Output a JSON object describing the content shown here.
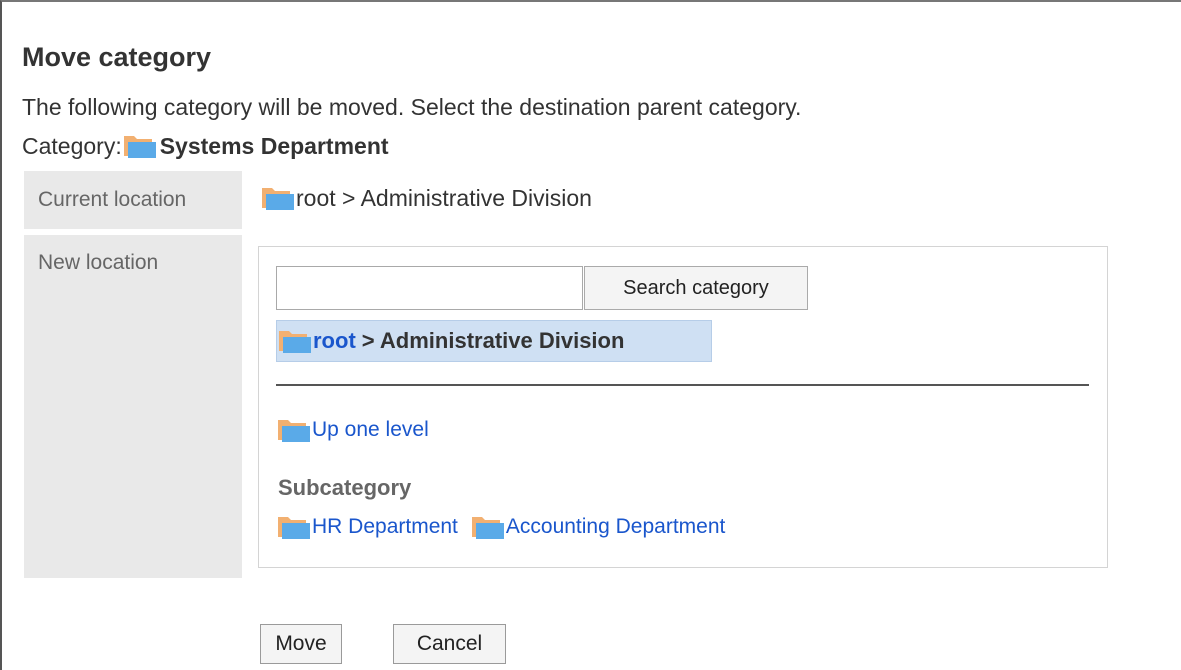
{
  "page": {
    "title": "Move category",
    "instruction": "The following category will be moved. Select the destination parent category.",
    "category_label": "Category:",
    "category_name": "Systems Department"
  },
  "current_location": {
    "label": "Current location",
    "value": "root > Administrative Division"
  },
  "new_location": {
    "label": "New location",
    "search": {
      "value": "",
      "placeholder": "",
      "button_label": "Search category"
    },
    "selected_path": {
      "root_link": "root",
      "rest": "> Administrative Division"
    },
    "up_one_level": "Up one level",
    "subcategory_heading": "Subcategory",
    "subcategories": [
      "HR Department",
      "Accounting Department"
    ]
  },
  "actions": {
    "move_label": "Move",
    "cancel_label": "Cancel"
  },
  "icons": {
    "folder": "folder-icon"
  },
  "colors": {
    "link": "#1a56cc",
    "selected_background": "#cfe0f3",
    "label_background": "#e9e9e9",
    "folder_front": "#5aaae8",
    "folder_back": "#f2b071"
  }
}
